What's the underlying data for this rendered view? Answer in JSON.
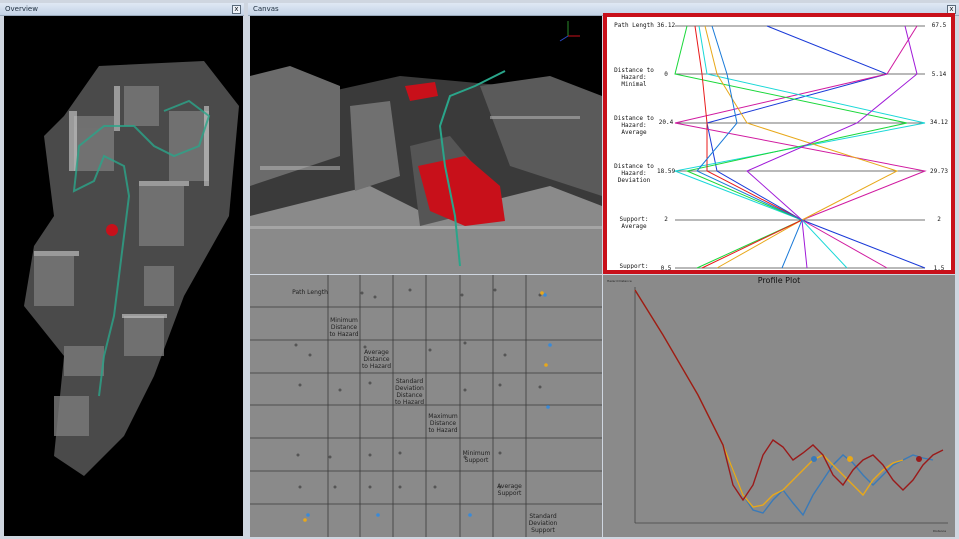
{
  "overview": {
    "title": "Overview",
    "close": "x"
  },
  "canvas": {
    "title": "Canvas",
    "close": "x"
  },
  "parallel": {
    "axes": [
      {
        "label": "Path Length",
        "min": "36.12",
        "max": "67.5"
      },
      {
        "label": "Distance to Hazard: Minimal",
        "min": "0",
        "max": "5.14"
      },
      {
        "label": "Distance to Hazard: Average",
        "min": "20.4",
        "max": "34.12"
      },
      {
        "label": "Distance to Hazard: Deviation",
        "min": "18.59",
        "max": "29.73"
      },
      {
        "label": "Support: Average",
        "min": "2",
        "max": "2"
      },
      {
        "label": "Support: Deviation",
        "min": "0.5",
        "max": "1.5"
      }
    ],
    "highlight_color": "#c8101a"
  },
  "splom": {
    "labels": [
      "Path Length",
      "Minimum Distance to Hazard",
      "Average Distance to Hazard",
      "Standard Deviation Distance to Hazard",
      "Maximum Distance to Hazard",
      "Minimum Support",
      "Average Support",
      "Standard Deviation Support"
    ]
  },
  "profile": {
    "title": "Profile Plot",
    "ylabel": "Hazard Distance",
    "xlabel": "Distance"
  },
  "colors": {
    "hazard": "#c8101a",
    "path": "#2aa58a",
    "accent": "#c8101a"
  }
}
